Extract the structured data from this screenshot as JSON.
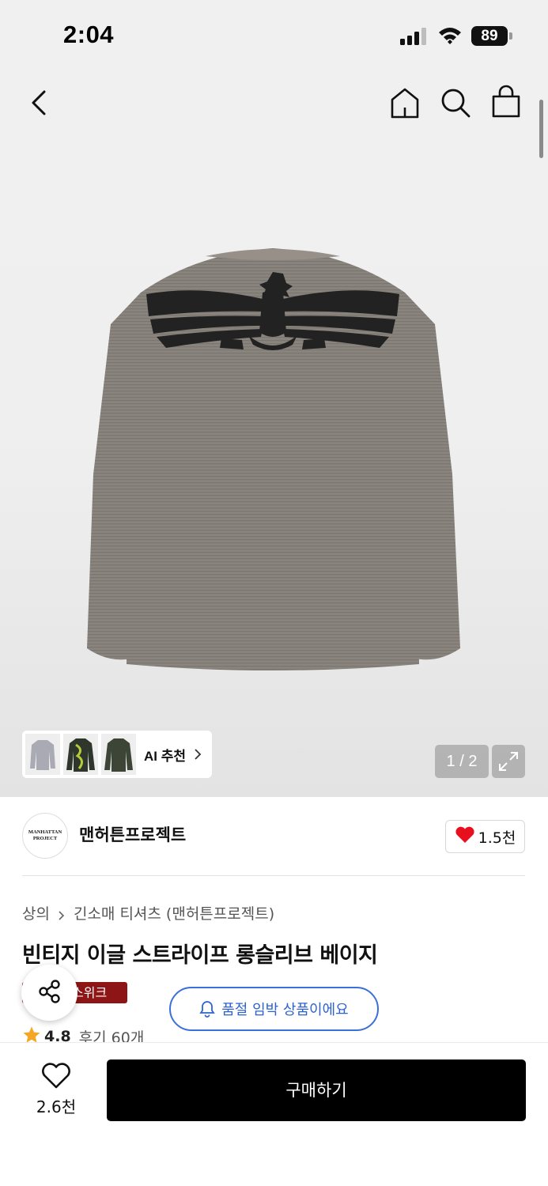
{
  "status_bar": {
    "time": "2:04",
    "battery": "89",
    "icons": [
      "signal-icon",
      "wifi-icon",
      "battery-icon"
    ]
  },
  "nav": {
    "icons": [
      "back-icon",
      "home-icon",
      "search-icon",
      "shopping-bag-icon"
    ]
  },
  "gallery": {
    "image": "product-image-grey-striped-longsleeve-eagle-print",
    "ai_recommend_label": "AI 추천",
    "thumbnails": [
      "thumbnail-grey-tee",
      "thumbnail-dragon-tee",
      "thumbnail-olive-tee"
    ],
    "page_counter": "1 / 2"
  },
  "brand": {
    "logo_text": "MANHATTAN PROJECT",
    "name": "맨허튼프로젝트",
    "like_count": "1.5천"
  },
  "product": {
    "breadcrumb": [
      "상의",
      "긴소매 티셔츠 (맨허튼프로젝트)"
    ],
    "title": "빈티지 이글 스트라이프 롱슬리브 베이지",
    "badge": "스위크",
    "rating": "4.8",
    "review_text": "후기 60개"
  },
  "restock_notice": "품절 임박 상품이에요",
  "bottom_bar": {
    "wish_count": "2.6천",
    "buy_label": "구매하기"
  },
  "colors": {
    "buy_button": "#000000",
    "badge": "#8e1515",
    "restock_blue": "#2e63cf",
    "heart_red": "#e8101e",
    "star": "#f5a623"
  }
}
